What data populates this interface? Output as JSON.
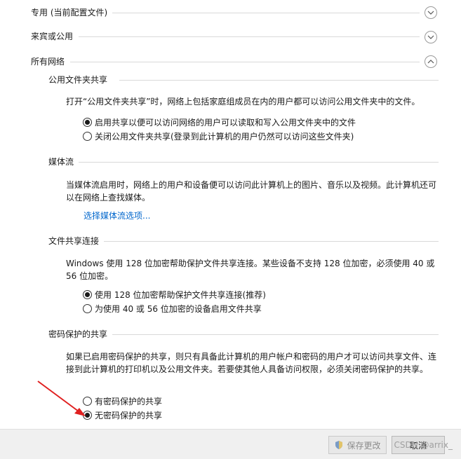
{
  "sections": {
    "private_label": "专用 (当前配置文件)",
    "guest_label": "来宾或公用",
    "all_label": "所有网络"
  },
  "public_folder": {
    "title": "公用文件夹共享",
    "description": "打开“公用文件夹共享”时，网络上包括家庭组成员在内的用户都可以访问公用文件夹中的文件。",
    "options": [
      "启用共享以便可以访问网络的用户可以读取和写入公用文件夹中的文件",
      "关闭公用文件夹共享(登录到此计算机的用户仍然可以访问这些文件夹)"
    ],
    "selected": 0
  },
  "media": {
    "title": "媒体流",
    "description": "当媒体流启用时，网络上的用户和设备便可以访问此计算机上的图片、音乐以及视频。此计算机还可以在网络上查找媒体。",
    "link": "选择媒体流选项..."
  },
  "file_sharing": {
    "title": "文件共享连接",
    "description": "Windows 使用 128 位加密帮助保护文件共享连接。某些设备不支持 128 位加密，必须使用 40 或 56 位加密。",
    "options": [
      "使用 128 位加密帮助保护文件共享连接(推荐)",
      "为使用 40 或 56 位加密的设备启用文件共享"
    ],
    "selected": 0
  },
  "password": {
    "title": "密码保护的共享",
    "description": "如果已启用密码保护的共享，则只有具备此计算机的用户帐户和密码的用户才可以访问共享文件、连接到此计算机的打印机以及公用文件夹。若要使其他人具备访问权限，必须关闭密码保护的共享。",
    "options": [
      "有密码保护的共享",
      "无密码保护的共享"
    ],
    "selected": 1
  },
  "footer": {
    "save_label": "保存更改",
    "cancel_label": "取消",
    "watermark": "CSDN @arrix_"
  },
  "colors": {
    "link": "#0066cc",
    "arrow": "#e02020"
  }
}
